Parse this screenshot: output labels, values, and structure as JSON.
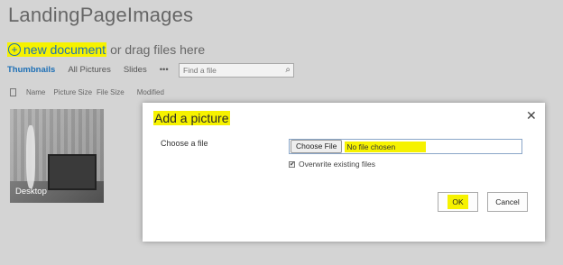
{
  "library": {
    "title": "LandingPageImages",
    "new_document": "new document",
    "drag_text": "or drag files here"
  },
  "views": {
    "items": [
      "Thumbnails",
      "All Pictures",
      "Slides",
      "•••"
    ],
    "search_placeholder": "Find a file"
  },
  "columns": [
    "Name",
    "Picture Size",
    "File Size",
    "Modified"
  ],
  "thumbnail": {
    "label": "Desktop"
  },
  "dialog": {
    "title": "Add a picture",
    "close": "✕",
    "choose_label": "Choose a file",
    "choose_button": "Choose File",
    "no_file": "No file chosen",
    "overwrite_label": "Overwrite existing files",
    "overwrite_checked": true,
    "ok": "OK",
    "cancel": "Cancel"
  },
  "colors": {
    "accent": "#1d6fb5",
    "highlight": "#f6f200",
    "background": "#d4d4d4"
  }
}
